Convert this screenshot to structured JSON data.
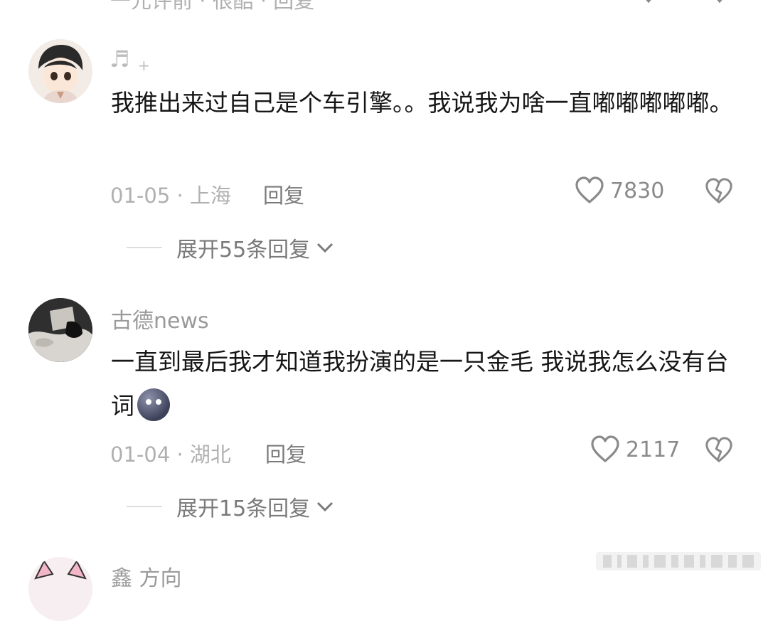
{
  "top_fragment": {
    "text": "一元评前 · 很酷 · 回复"
  },
  "comments": [
    {
      "username": "♬",
      "username_plus": "+",
      "text": "我推出来过自己是个车引擎。。我说我为啥一直嘟嘟嘟嘟嘟。",
      "date_location": "01-05 · 上海",
      "reply_label": "回复",
      "likes": "7830",
      "expand_label": "展开55条回复"
    },
    {
      "username": "古德news",
      "text": "一直到最后我才知道我扮演的是一只金毛 我说我怎么没有台词",
      "date_location": "01-04 · 湖北",
      "reply_label": "回复",
      "likes": "2117",
      "expand_label": "展开15条回复"
    },
    {
      "username": "鑫 方向"
    }
  ],
  "colors": {
    "text": "#161616",
    "meta": "#b0b0b0",
    "icon": "#8a8a8a"
  }
}
